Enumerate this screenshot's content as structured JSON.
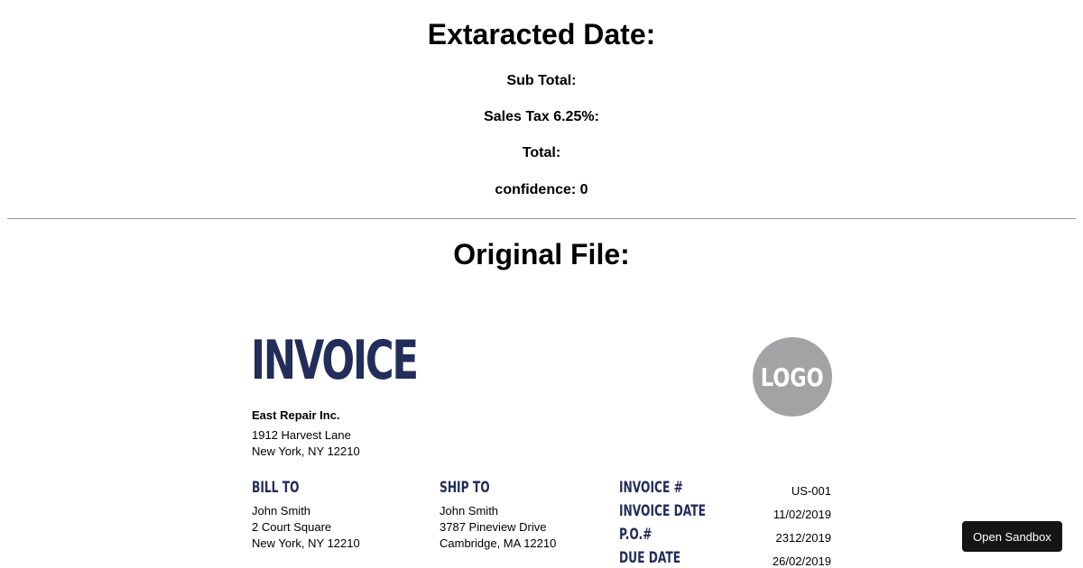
{
  "extracted": {
    "heading": "Extaracted Date:",
    "sub_total": "Sub Total:",
    "sales_tax": "Sales Tax 6.25%:",
    "total": "Total:",
    "confidence": "confidence: 0"
  },
  "original": {
    "heading": "Original File:"
  },
  "invoice": {
    "title": "INVOICE",
    "logo": "LOGO",
    "company": {
      "name": "East Repair Inc.",
      "street": "1912 Harvest Lane",
      "city": "New York, NY 12210"
    },
    "bill_to": {
      "label": "BILL TO",
      "name": "John Smith",
      "street": "2 Court Square",
      "city": "New York, NY 12210"
    },
    "ship_to": {
      "label": "SHIP TO",
      "name": "John Smith",
      "street": "3787 Pineview Drive",
      "city": "Cambridge, MA 12210"
    },
    "meta": [
      {
        "label": "INVOICE #",
        "value": "US-001"
      },
      {
        "label": "INVOICE DATE",
        "value": "11/02/2019"
      },
      {
        "label": "P.O.#",
        "value": "2312/2019"
      },
      {
        "label": "DUE DATE",
        "value": "26/02/2019"
      }
    ]
  },
  "sandbox": {
    "button_label": "Open Sandbox"
  },
  "colors": {
    "invoice_navy": "#222d59",
    "logo_gray": "#a3a3a6",
    "button_bg": "#151515"
  }
}
